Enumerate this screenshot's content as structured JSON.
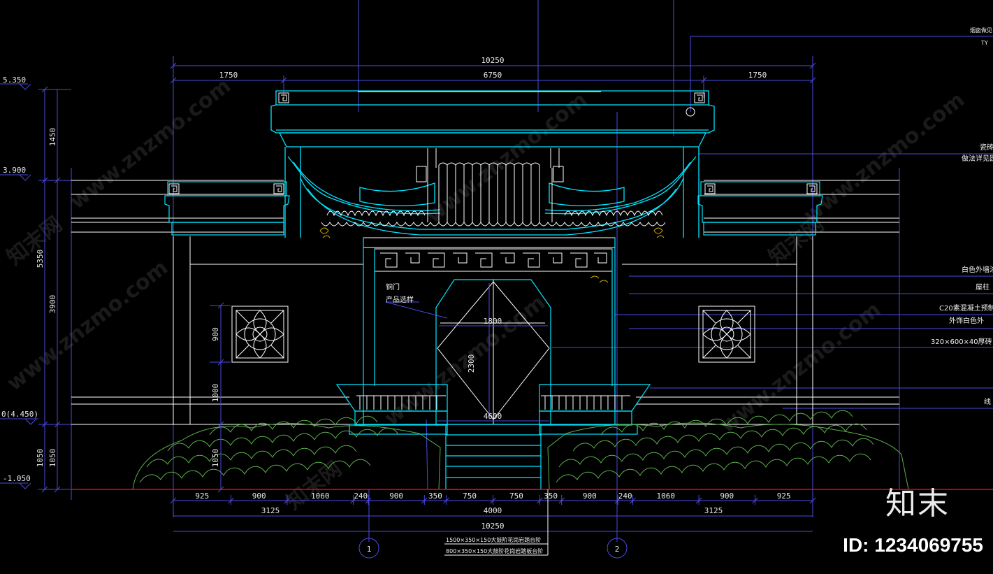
{
  "dims_top": {
    "overall": "10250",
    "left_bay": "1750",
    "center_bay": "6750",
    "right_bay": "1750"
  },
  "dims_bottom": {
    "segments": [
      "925",
      "900",
      "1060",
      "240",
      "900",
      "350",
      "750",
      "750",
      "350",
      "900",
      "240",
      "1060",
      "900",
      "925"
    ],
    "sub_left": "3125",
    "sub_center": "4000",
    "sub_right": "3125",
    "overall": "10250"
  },
  "dims_left": {
    "outer_1450": "1450",
    "outer_5350": "5350",
    "outer_1050": "1050",
    "inner_3900": "3900",
    "inner_1050": "1050"
  },
  "dims_inner": {
    "window_900": "900",
    "wall_1000": "1000",
    "step_1050": "1050",
    "door_width": "1800",
    "door_height": "2300",
    "base_width": "4600"
  },
  "levels": {
    "top": "5.350",
    "mid": "3.900",
    "floor": "0(4.450)",
    "bottom": "-1.050"
  },
  "grid_axes": [
    "1",
    "2"
  ],
  "callouts_left": {
    "door": "铜门",
    "product": "产品选样"
  },
  "callouts_right": [
    "烟囱做见",
    "TY",
    "瓷砖做",
    "做法详见园林",
    "白色外墙涂料",
    "屋柱",
    "C20素混凝土预制",
    "外饰白色外",
    "320×600×40厚砖",
    "线"
  ],
  "notes_bottom": [
    "1500×350×150大鼓阶花岗岩踏台阶",
    "800×350×150大鼓阶花岗岩踏板台阶"
  ],
  "watermark": "www.znzmo.com",
  "watermark_cn": "知末网",
  "brand": "知末",
  "image_id": "ID: 1234069755",
  "colors": {
    "background": "#000000",
    "outline": "#00e5ff",
    "structure": "#ffffff",
    "dimension": "#4a4ae0",
    "ground": "#ff0000",
    "planting": "#5ab04a",
    "highlight": "#ffff00"
  }
}
